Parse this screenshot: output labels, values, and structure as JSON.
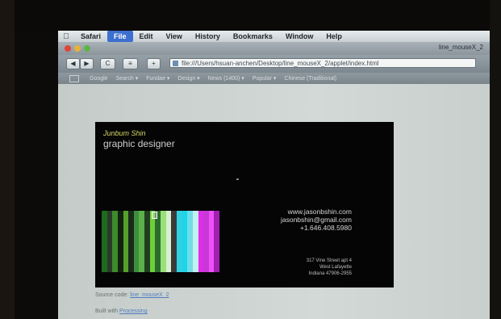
{
  "menubar": {
    "items": [
      "Safari",
      "File",
      "Edit",
      "View",
      "History",
      "Bookmarks",
      "Window",
      "Help"
    ],
    "active": "File"
  },
  "window": {
    "title": "line_mouseX_2"
  },
  "toolbar": {
    "back": "◀",
    "forward": "▶",
    "reload": "C",
    "bookmark": "≡",
    "add": "+",
    "url": "file:///Users/hsuan-anchen/Desktop/line_mouseX_2/applet/index.html"
  },
  "bookmarks": [
    "Google",
    "Search ▾",
    "Fundae ▾",
    "Design ▾",
    "News (1400) ▾",
    "Popular ▾",
    "Chinese (Traditional)"
  ],
  "card": {
    "name": "Junbum Shin",
    "role": "graphic designer",
    "website": "www.jasonbshin.com",
    "email": "jasonbshin@gmail.com",
    "phone": "+1.646.408.5980",
    "address1": "317 Vine Street apt 4",
    "address2": "West Lafayette",
    "address3": "Indiana 47906-2955",
    "stripe_colors": [
      "#1d6b1d",
      "#2a3a2a",
      "#3f8a2a",
      "#112211",
      "#55a02a",
      "#1a2a1a",
      "#3c8f3c",
      "#5bb14a",
      "#1f3f1f",
      "#6fcf3a",
      "#2b6b2b",
      "#98e07a",
      "#d8f0d0",
      "#3a3a3a",
      "#31d0e0",
      "#1ad6e8",
      "#6fdde8",
      "#c0f0f0",
      "#e02ee8",
      "#c838d8",
      "#f050f8",
      "#a020b0"
    ]
  },
  "footer": {
    "source_label": "Source code:",
    "source_link": "line_mouseX_2",
    "built_label": "Built with",
    "built_link": "Processing"
  }
}
